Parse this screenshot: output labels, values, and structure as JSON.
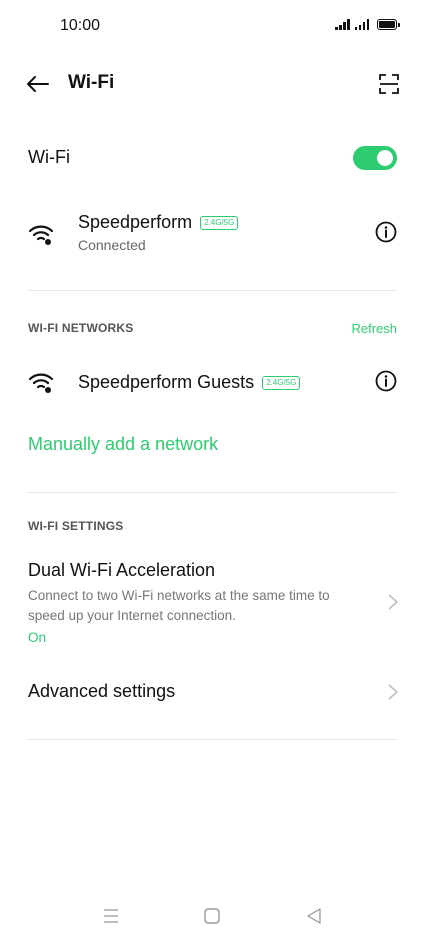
{
  "status_bar": {
    "time": "10:00",
    "icons": [
      "signal-icon",
      "signal-icon",
      "battery-icon"
    ]
  },
  "app_bar": {
    "title": "Wi-Fi",
    "back_icon": "arrow-left-icon",
    "scan_icon": "qr-scan-icon"
  },
  "wifi_toggle": {
    "label": "Wi-Fi",
    "enabled": true
  },
  "connected_network": {
    "name": "Speedperform",
    "band": "2.4G/5G",
    "status": "Connected"
  },
  "networks_section": {
    "header": "WI-FI NETWORKS",
    "refresh_label": "Refresh",
    "items": [
      {
        "name": "Speedperform Guests",
        "band": "2.4G/5G"
      }
    ],
    "manual_add_label": "Manually add a network"
  },
  "settings_section": {
    "header": "WI-FI SETTINGS",
    "dual_acceleration": {
      "title": "Dual Wi-Fi Acceleration",
      "description": "Connect to two Wi-Fi networks at the same time to speed up your Internet connection.",
      "value": "On"
    },
    "advanced": {
      "title": "Advanced settings"
    }
  },
  "colors": {
    "accent": "#2ecc71",
    "text_primary": "#111111",
    "text_secondary": "#777777"
  }
}
